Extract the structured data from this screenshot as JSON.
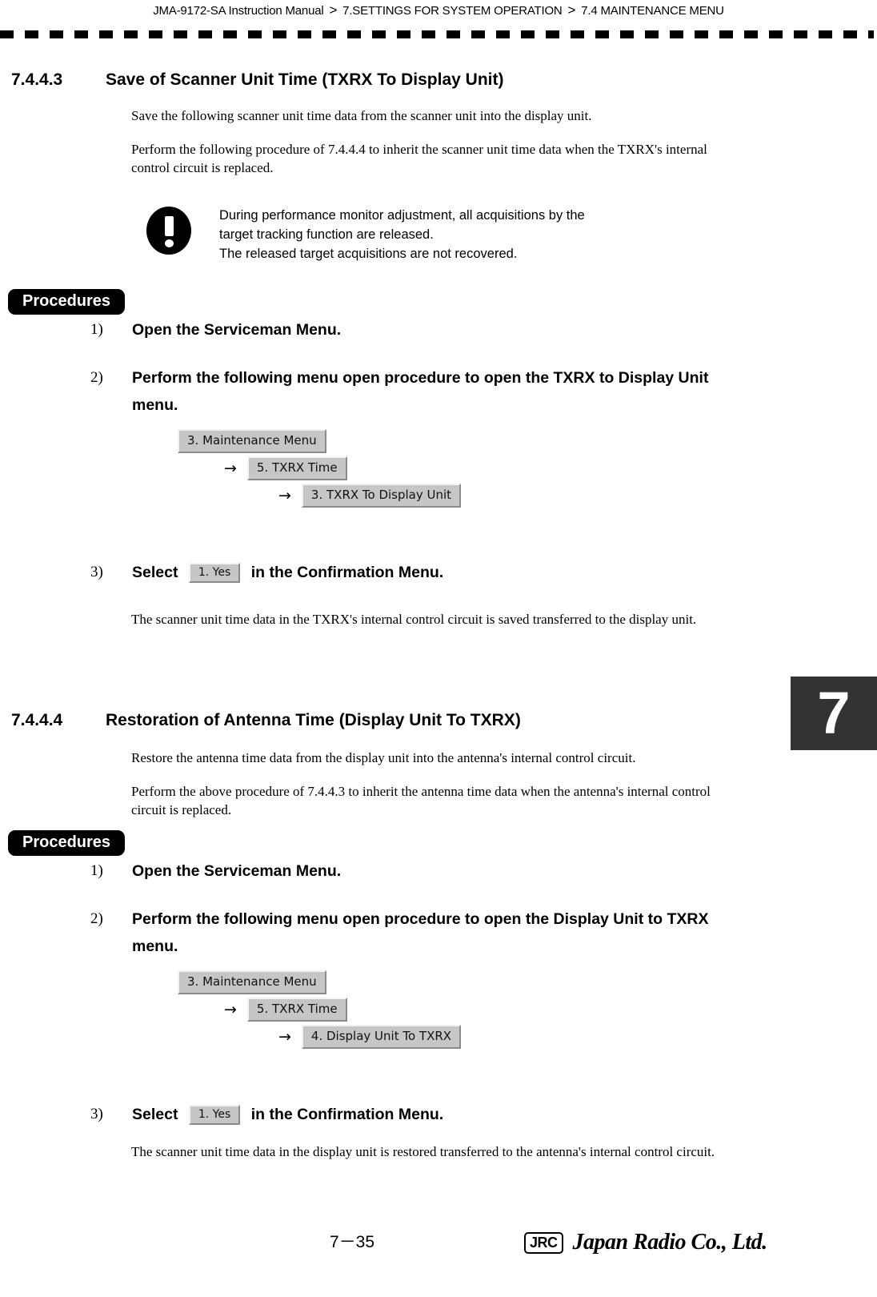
{
  "header": {
    "manual": "JMA-9172-SA Instruction Manual",
    "separator": ">",
    "chapter": "7.SETTINGS FOR SYSTEM OPERATION",
    "section": "7.4  MAINTENANCE MENU"
  },
  "chapter_tab": {
    "number": "7"
  },
  "sections": [
    {
      "number": "7.4.4.3",
      "title": "Save of Scanner Unit Time (TXRX To Display Unit)",
      "intro1": "Save the following scanner unit time data from the scanner unit into the display unit.",
      "intro2": "Perform the following procedure of 7.4.4.4 to inherit the scanner unit time data when the TXRX's internal control circuit is replaced.",
      "caution": {
        "icon": "exclamation-circle-icon",
        "text": "During performance monitor adjustment, all acquisitions by the\ntarget tracking function are released.\nThe released target acquisitions are not recovered."
      },
      "procedures_label": "Procedures",
      "steps": [
        {
          "index": "1)",
          "text": "Open the Serviceman Menu."
        },
        {
          "index": "2)",
          "text": "Perform the following menu open procedure to open the TXRX to Display Unit menu."
        },
        {
          "index": "3)",
          "pre": "Select",
          "button": "1. Yes",
          "post": "in the Confirmation Menu."
        }
      ],
      "menu_chain": [
        "3. Maintenance Menu",
        "5. TXRX Time",
        "3. TXRX To Display Unit"
      ],
      "arrow": "→",
      "result": "The scanner unit time data in the TXRX's internal control circuit is saved transferred to the display unit."
    },
    {
      "number": "7.4.4.4",
      "title": "Restoration of Antenna Time (Display Unit To TXRX)",
      "intro1": "Restore the antenna time data from the display unit into the antenna's internal control circuit.",
      "intro2": "Perform the above procedure of 7.4.4.3 to inherit the antenna time data when the antenna's internal control circuit is replaced.",
      "procedures_label": "Procedures",
      "steps": [
        {
          "index": "1)",
          "text": "Open the Serviceman Menu."
        },
        {
          "index": "2)",
          "text": "Perform the following menu open procedure to open the Display Unit to TXRX menu."
        },
        {
          "index": "3)",
          "pre": "Select",
          "button": "1. Yes",
          "post": "in the Confirmation Menu."
        }
      ],
      "menu_chain": [
        "3. Maintenance Menu",
        "5. TXRX Time",
        "4. Display Unit To TXRX"
      ],
      "arrow": "→",
      "result": "The scanner unit time data in the display unit is restored transferred to the antenna's internal control circuit."
    }
  ],
  "footer": {
    "page_number": "7－35",
    "logo_mark": "JRC",
    "company": "Japan Radio Co., Ltd."
  }
}
